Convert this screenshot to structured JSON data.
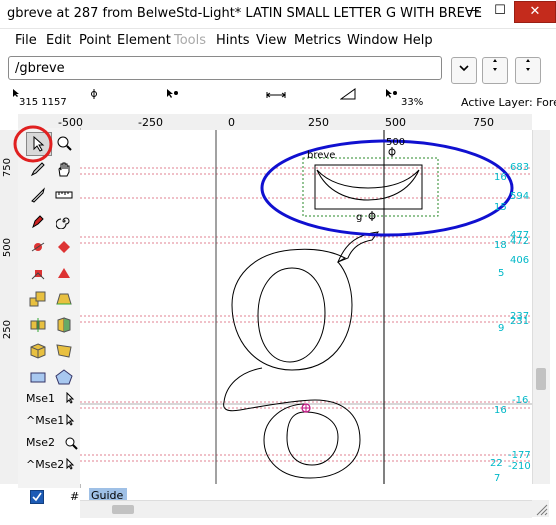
{
  "window": {
    "title": "gbreve at 287 from BelweStd-Light* LATIN SMALL LETTER G WITH BREVE",
    "min_label": "—",
    "max_label": "☐",
    "close_label": "✕"
  },
  "menu": [
    {
      "label": "File",
      "enabled": true
    },
    {
      "label": "Edit",
      "enabled": true
    },
    {
      "label": "Point",
      "enabled": true
    },
    {
      "label": "Element",
      "enabled": true
    },
    {
      "label": "Tools",
      "enabled": false
    },
    {
      "label": "Hints",
      "enabled": true
    },
    {
      "label": "View",
      "enabled": true
    },
    {
      "label": "Metrics",
      "enabled": true
    },
    {
      "label": "Window",
      "enabled": true
    },
    {
      "label": "Help",
      "enabled": true
    }
  ],
  "glyph_field": {
    "value": "/gbreve"
  },
  "info": {
    "coords": "315 1157",
    "zoom": "33%",
    "active_layer": "Active Layer: Fore"
  },
  "ruler": {
    "ticks": [
      "-500",
      "-250",
      "0",
      "250",
      "500",
      "750"
    ],
    "vticks": [
      "750",
      "500",
      "250"
    ]
  },
  "palette": {
    "layers": [
      {
        "label": "Mse1"
      },
      {
        "label": "^Mse1"
      },
      {
        "label": "Mse2"
      },
      {
        "label": "^Mse2"
      }
    ],
    "guide_hash": "#",
    "guide_label": "Guide"
  },
  "canvas": {
    "breve_label": "breve",
    "g_label": "g",
    "top_label": "500",
    "right_labels": [
      {
        "text": "683"
      },
      {
        "text": "16"
      },
      {
        "text": "594"
      },
      {
        "text": "15"
      },
      {
        "text": "477"
      },
      {
        "text": "472"
      },
      {
        "text": "18"
      },
      {
        "text": "406"
      },
      {
        "text": "5"
      },
      {
        "text": "237"
      },
      {
        "text": "231"
      },
      {
        "text": "9"
      },
      {
        "text": "-16"
      },
      {
        "text": "16"
      },
      {
        "text": "-177"
      },
      {
        "text": "22"
      },
      {
        "text": "-210"
      },
      {
        "text": "7"
      }
    ]
  },
  "colors": {
    "selection_red": "#e02020",
    "annotation_blue": "#1010d0",
    "metric_cyan": "#00b8c8",
    "guide_pink": "#e08090"
  }
}
